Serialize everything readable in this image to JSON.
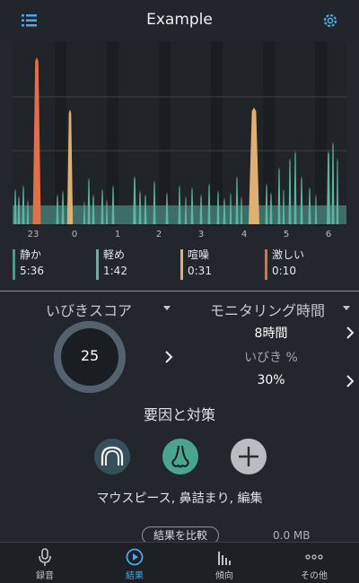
{
  "header": {
    "title": "Example",
    "menu_icon": "list-icon",
    "settings_icon": "gear-icon"
  },
  "colors": {
    "quiet": "#4a9a8c",
    "light": "#5bb5a0",
    "loud": "#e0b070",
    "epic": "#e0704a",
    "accent": "#4ea8e6",
    "background": "#23272d"
  },
  "chart_data": {
    "type": "area",
    "x_ticks": [
      "23",
      "0",
      "1",
      "2",
      "3",
      "4",
      "5",
      "6"
    ],
    "series": [
      {
        "name": "静か",
        "color": "#4a9a8c"
      },
      {
        "name": "軽め",
        "color": "#5bb5a0"
      },
      {
        "name": "喧噪",
        "color": "#e0b070"
      },
      {
        "name": "激しい",
        "color": "#e0704a"
      }
    ],
    "grid": true
  },
  "legend": [
    {
      "name": "静か",
      "value": "5:36",
      "color": "#4a9a8c"
    },
    {
      "name": "軽め",
      "value": "1:42",
      "color": "#5bb5a0"
    },
    {
      "name": "喧噪",
      "value": "0:31",
      "color": "#e0b070"
    },
    {
      "name": "激しい",
      "value": "0:10",
      "color": "#e0704a"
    }
  ],
  "score": {
    "label": "いびきスコア",
    "value": "25",
    "gauge_fraction": 0.25
  },
  "monitoring": {
    "label": "モニタリング時間",
    "duration": "8時間",
    "snore_label": "いびき %",
    "snore_value": "30%"
  },
  "remedies": {
    "title": "要因と対策",
    "items": [
      "mouthpiece-icon",
      "nose-icon",
      "plus-icon"
    ],
    "text": "マウスピース, 鼻詰まり, 編集"
  },
  "footer": {
    "compare_label": "結果を比較",
    "size": "0.0 MB"
  },
  "nav": [
    {
      "label": "録音",
      "icon": "microphone-icon"
    },
    {
      "label": "結果",
      "icon": "play-circle-icon",
      "active": true
    },
    {
      "label": "傾向",
      "icon": "bars-icon"
    },
    {
      "label": "その他",
      "icon": "more-icon"
    }
  ]
}
